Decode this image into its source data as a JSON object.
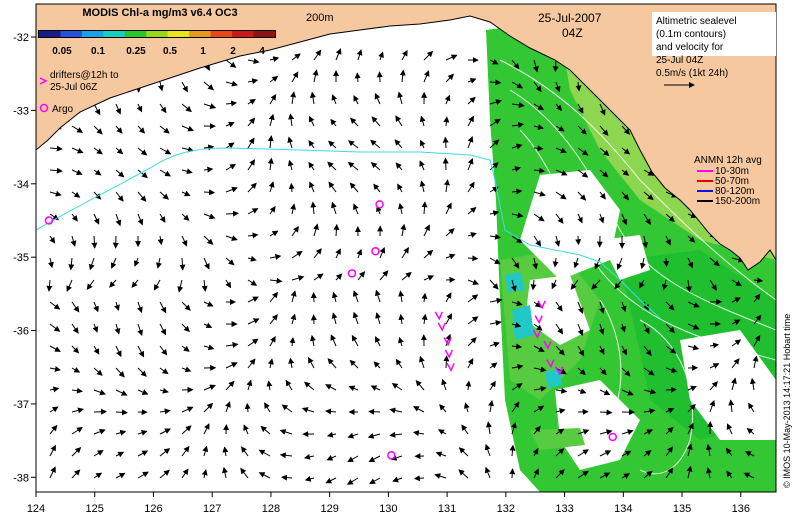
{
  "colorbar": {
    "title": "MODIS Chl-a mg/m3 v6.4 OC3",
    "ticks": [
      "0.05",
      "0.1",
      "0.25",
      "0.5",
      "1",
      "2",
      "4"
    ],
    "colors": [
      "#1a1a8c",
      "#2a4fd8",
      "#1aa0e8",
      "#19d0c0",
      "#28c828",
      "#98d818",
      "#e8e818",
      "#e89818",
      "#e84818",
      "#c81818",
      "#8c1414"
    ]
  },
  "labels": {
    "isobath": "200m",
    "date": "25-Jul-2007",
    "hour": "04Z",
    "drifters_line1": "drifters@12h to",
    "drifters_line2": "25-Jul 06Z",
    "argo": "Argo",
    "credit": "© IMOS 10-May-2013 14:17:21 Hobart time"
  },
  "sealevel_legend": {
    "lines": [
      "Altimetric sealevel",
      "(0.1m contours)",
      "and velocity for",
      "25-Jul 04Z",
      "0.5m/s (1kt 24h)"
    ]
  },
  "anmn_legend": {
    "title": "ANMN 12h avg",
    "items": [
      {
        "label": "10-30m",
        "color": "#ff00ff"
      },
      {
        "label": "50-70m",
        "color": "#e00000"
      },
      {
        "label": "80-120m",
        "color": "#1010e0"
      },
      {
        "label": "150-200m",
        "color": "#000000"
      }
    ]
  },
  "axes": {
    "x_ticks": [
      "124",
      "125",
      "126",
      "127",
      "128",
      "129",
      "130",
      "131",
      "132",
      "133",
      "134",
      "135",
      "136"
    ],
    "y_ticks": [
      "-32",
      "-33",
      "-34",
      "-35",
      "-36",
      "-37",
      "-38"
    ]
  },
  "colors": {
    "land": "#f6c8a0",
    "ocean": "#ffffff",
    "chl_low": "#22cc22",
    "chl_mid": "#7fd850",
    "chl_cyan": "#22c8c8",
    "isobath": "#40d8e8",
    "drifter": "#ff00ff"
  },
  "argo_floats": [
    {
      "lon": 124.22,
      "lat": -34.5
    },
    {
      "lon": 129.85,
      "lat": -34.28
    },
    {
      "lon": 129.78,
      "lat": -34.92
    },
    {
      "lon": 129.38,
      "lat": -35.22
    },
    {
      "lon": 130.05,
      "lat": -37.7
    },
    {
      "lon": 133.82,
      "lat": -37.45
    }
  ],
  "drifters": [
    {
      "lon": 130.85,
      "lat": -35.8
    },
    {
      "lon": 130.9,
      "lat": -35.95
    },
    {
      "lon": 131.0,
      "lat": -36.15
    },
    {
      "lon": 131.02,
      "lat": -36.32
    },
    {
      "lon": 131.05,
      "lat": -36.5
    },
    {
      "lon": 132.55,
      "lat": -35.85
    },
    {
      "lon": 132.52,
      "lat": -36.05
    },
    {
      "lon": 132.7,
      "lat": -36.2
    },
    {
      "lon": 132.75,
      "lat": -36.45
    },
    {
      "lon": 132.9,
      "lat": -36.55
    },
    {
      "lon": 132.6,
      "lat": -35.65
    }
  ]
}
